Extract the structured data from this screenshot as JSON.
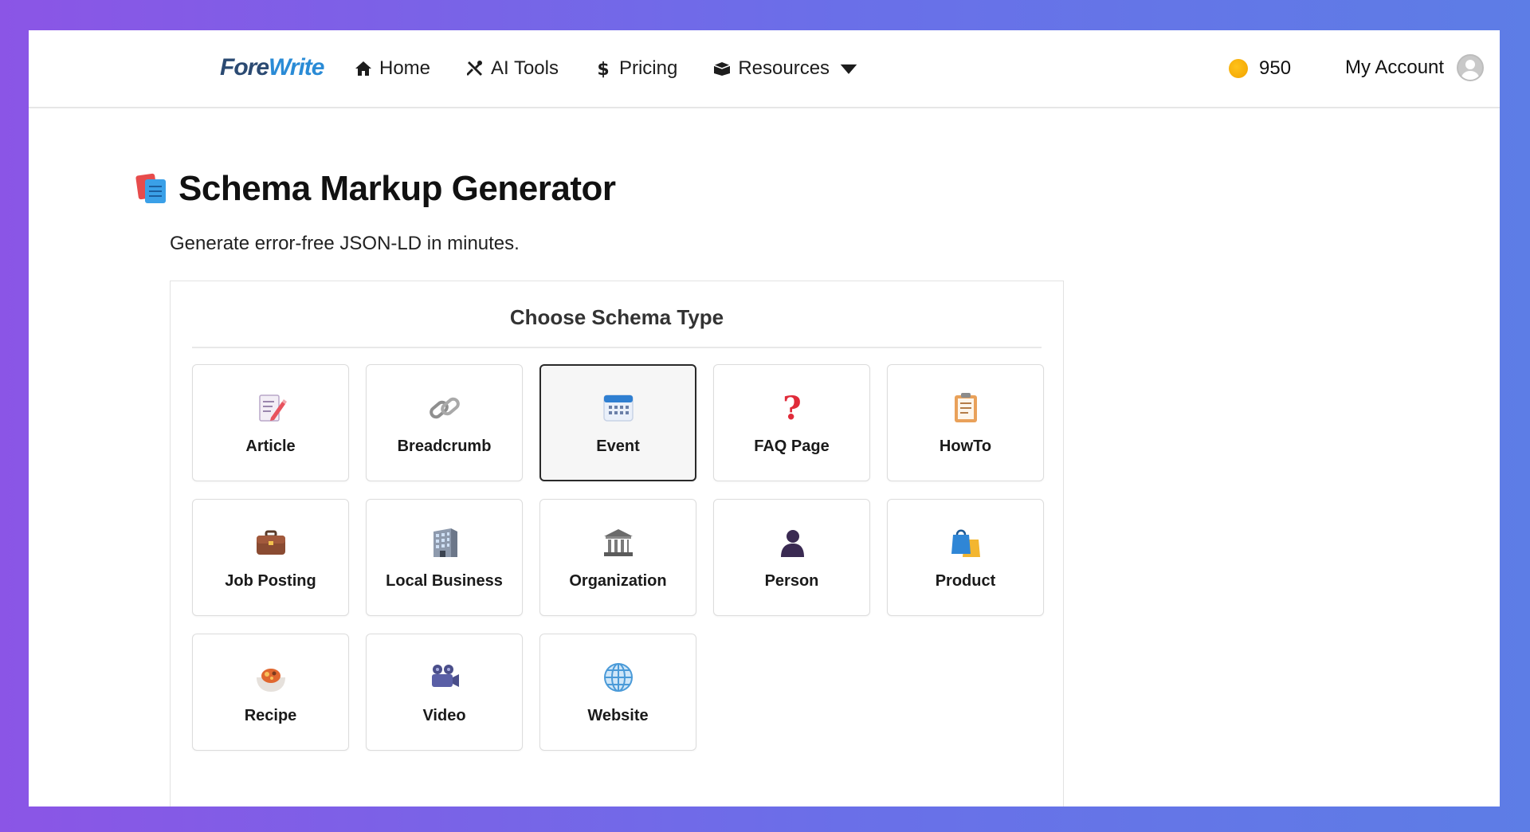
{
  "brand": {
    "part1": "Fore",
    "part2": "Write"
  },
  "nav": [
    {
      "label": "Home",
      "icon": "home-icon"
    },
    {
      "label": "AI Tools",
      "icon": "tools-icon"
    },
    {
      "label": "Pricing",
      "icon": "dollar-icon"
    },
    {
      "label": "Resources",
      "icon": "box-icon"
    }
  ],
  "credits": {
    "value": "950",
    "icon": "coin-icon",
    "color": "#f5a800"
  },
  "account": {
    "label": "My Account",
    "icon": "avatar-icon"
  },
  "page": {
    "title": "Schema Markup Generator",
    "subtitle": "Generate error-free JSON-LD in minutes."
  },
  "chooser": {
    "title": "Choose Schema Type",
    "selected": "Event",
    "types": [
      {
        "label": "Article",
        "icon": "article-icon"
      },
      {
        "label": "Breadcrumb",
        "icon": "link-icon"
      },
      {
        "label": "Event",
        "icon": "calendar-icon"
      },
      {
        "label": "FAQ Page",
        "icon": "question-icon"
      },
      {
        "label": "HowTo",
        "icon": "clipboard-icon"
      },
      {
        "label": "Job Posting",
        "icon": "briefcase-icon"
      },
      {
        "label": "Local Business",
        "icon": "office-building-icon"
      },
      {
        "label": "Organization",
        "icon": "institution-icon"
      },
      {
        "label": "Person",
        "icon": "person-icon"
      },
      {
        "label": "Product",
        "icon": "shopping-bags-icon"
      },
      {
        "label": "Recipe",
        "icon": "food-bowl-icon"
      },
      {
        "label": "Video",
        "icon": "video-camera-icon"
      },
      {
        "label": "Website",
        "icon": "globe-icon"
      }
    ]
  }
}
